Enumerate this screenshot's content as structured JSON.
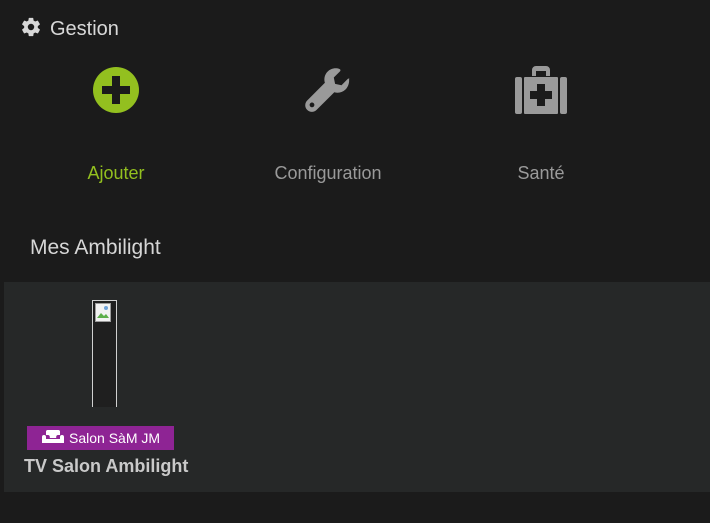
{
  "gestion": {
    "title": "Gestion",
    "icon": "gear-icon"
  },
  "actions": [
    {
      "label": "Ajouter",
      "icon": "add-circle-icon",
      "color": "#93c01f"
    },
    {
      "label": "Configuration",
      "icon": "wrench-icon",
      "color": "#9a9a9a"
    },
    {
      "label": "Santé",
      "icon": "medkit-icon",
      "color": "#9a9a9a"
    }
  ],
  "section": {
    "title": "Mes Ambilight"
  },
  "devices": [
    {
      "name": "TV Salon Ambilight",
      "room": "Salon SàM JM",
      "room_icon": "sofa-icon",
      "room_color": "#8e2494",
      "thumbnail": "broken-image-icon"
    }
  ]
}
